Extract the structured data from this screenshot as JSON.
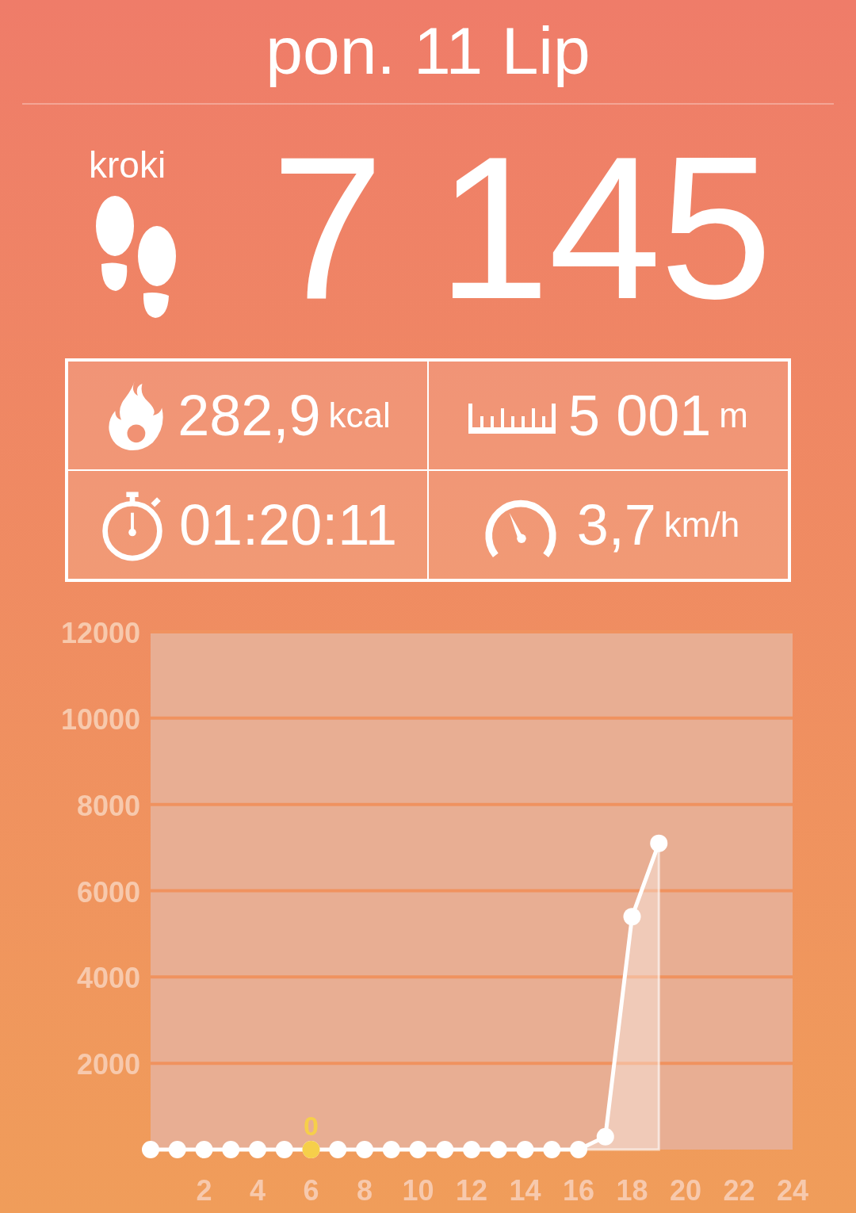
{
  "date": "pon. 11 Lip",
  "steps": {
    "label": "kroki",
    "value": "7 145"
  },
  "stats": [
    {
      "kind": "calories",
      "value": "282,9",
      "unit": "kcal"
    },
    {
      "kind": "distance",
      "value": "5 001",
      "unit": "m"
    },
    {
      "kind": "duration",
      "value": "01:20:11"
    },
    {
      "kind": "speed",
      "value": "3,7",
      "unit": "km/h"
    }
  ],
  "chart": {
    "chart_data": {
      "type": "area",
      "x": [
        0,
        1,
        2,
        3,
        4,
        5,
        6,
        7,
        8,
        9,
        10,
        11,
        12,
        13,
        14,
        15,
        16,
        17,
        18,
        19
      ],
      "series": [
        {
          "color": "#ffffff",
          "values": [
            0,
            0,
            0,
            0,
            0,
            0,
            0,
            0,
            0,
            0,
            0,
            0,
            0,
            0,
            0,
            0,
            0,
            300,
            5400,
            7100
          ]
        }
      ],
      "grid": true,
      "xlim": [
        0,
        24
      ],
      "ylim": [
        0,
        12000
      ],
      "xticks": [
        2,
        4,
        6,
        8,
        10,
        12,
        14,
        16,
        18,
        20,
        22,
        24
      ],
      "yticks": [
        2000,
        4000,
        6000,
        8000,
        10000,
        12000
      ],
      "annotations": [
        {
          "x": 6,
          "y": 0,
          "text": "0"
        }
      ]
    },
    "highlight": {
      "color": "#f6cf4a"
    }
  }
}
